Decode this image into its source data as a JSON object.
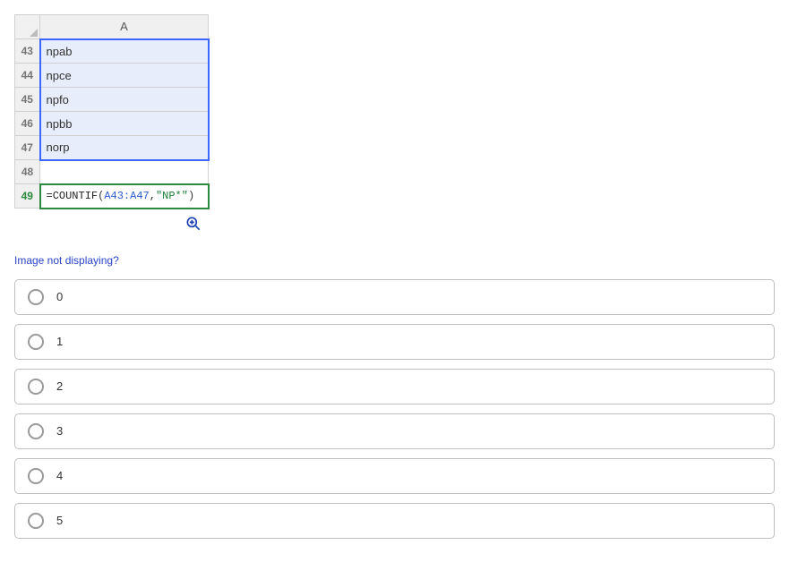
{
  "spreadsheet": {
    "column_header": "A",
    "rows": [
      {
        "num": "43",
        "value": "npab",
        "selected": true
      },
      {
        "num": "44",
        "value": "npce",
        "selected": true
      },
      {
        "num": "45",
        "value": "npfo",
        "selected": true
      },
      {
        "num": "46",
        "value": "npbb",
        "selected": true
      },
      {
        "num": "47",
        "value": "norp",
        "selected": true
      },
      {
        "num": "48",
        "value": "",
        "selected": false
      }
    ],
    "formula_row": {
      "num": "49",
      "eq": "=",
      "fn": "COUNTIF",
      "open": "(",
      "ref": "A43:A47",
      "comma": ",",
      "str": "\"NP*\"",
      "close": ")"
    }
  },
  "links": {
    "image_not_displaying": "Image not displaying?"
  },
  "options": [
    {
      "label": "0"
    },
    {
      "label": "1"
    },
    {
      "label": "2"
    },
    {
      "label": "3"
    },
    {
      "label": "4"
    },
    {
      "label": "5"
    }
  ]
}
